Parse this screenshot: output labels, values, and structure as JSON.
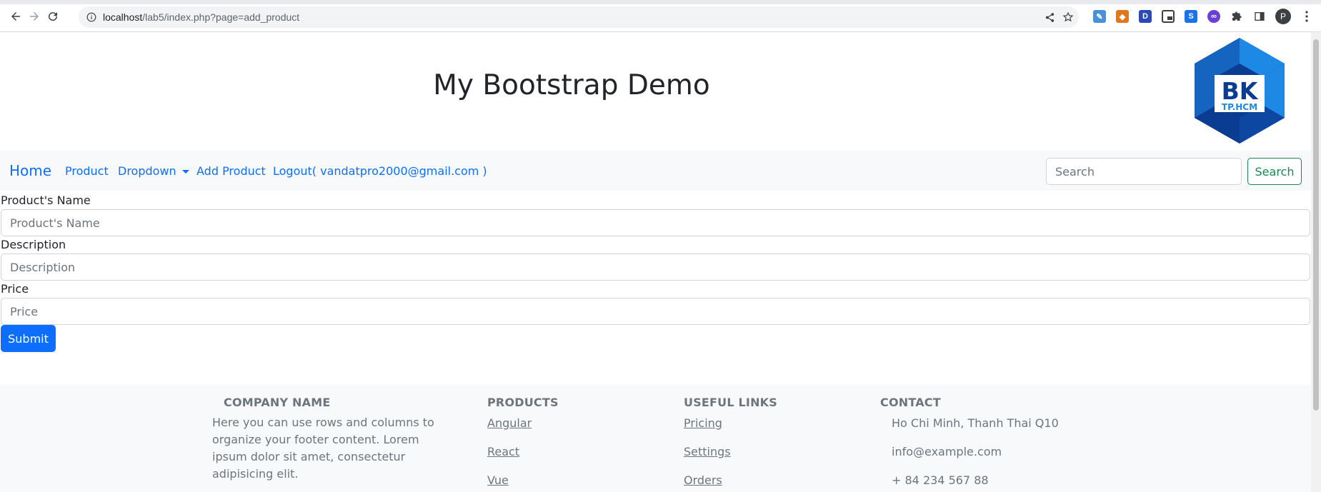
{
  "browser": {
    "url_host": "localhost",
    "url_path": "/lab5/index.php?page=add_product",
    "profile_initial": "P",
    "extensions": [
      {
        "name": "pencil-extension-icon",
        "color": "#4a90d9",
        "glyph": "✎"
      },
      {
        "name": "metamask-extension-icon",
        "color": "#e2761b",
        "glyph": "◆"
      },
      {
        "name": "d-extension-icon",
        "color": "#2a4bb5",
        "glyph": "D"
      },
      {
        "name": "picture-in-picture-icon",
        "color": "#3c4043",
        "glyph": "▣"
      },
      {
        "name": "s-extension-icon",
        "color": "#1a73e8",
        "glyph": "S"
      },
      {
        "name": "purple-extension-icon",
        "color": "#6a3fd6",
        "glyph": "●"
      }
    ]
  },
  "header": {
    "title": "My Bootstrap Demo",
    "logo_text": "BK",
    "logo_subtext": "TP.HCM"
  },
  "navbar": {
    "brand": "Home",
    "links": [
      "Product",
      "Dropdown",
      "Add Product",
      "Logout( vandatpro2000@gmail.com )"
    ],
    "search_placeholder": "Search",
    "search_button": "Search"
  },
  "form": {
    "name_label": "Product's Name",
    "name_placeholder": "Product's Name",
    "description_label": "Description",
    "description_placeholder": "Description",
    "price_label": "Price",
    "price_placeholder": "Price",
    "submit_label": "Submit"
  },
  "footer": {
    "company_heading": "COMPANY NAME",
    "company_text_lines": [
      "Here you can use rows and columns to",
      "organize your footer content. Lorem",
      "ipsum dolor sit amet, consectetur",
      "adipisicing elit."
    ],
    "products_heading": "PRODUCTS",
    "products": [
      "Angular",
      "React",
      "Vue"
    ],
    "links_heading": "USEFUL LINKS",
    "links": [
      "Pricing",
      "Settings",
      "Orders"
    ],
    "contact_heading": "CONTACT",
    "contact": [
      "Ho Chi Minh, Thanh Thai Q10",
      "info@example.com",
      "+ 84 234 567 88"
    ]
  },
  "colors": {
    "primary": "#0d6efd",
    "success": "#198754",
    "navbar_bg": "#f8f9fa",
    "logo_dark": "#0a3d91",
    "logo_light": "#1e88e5"
  }
}
